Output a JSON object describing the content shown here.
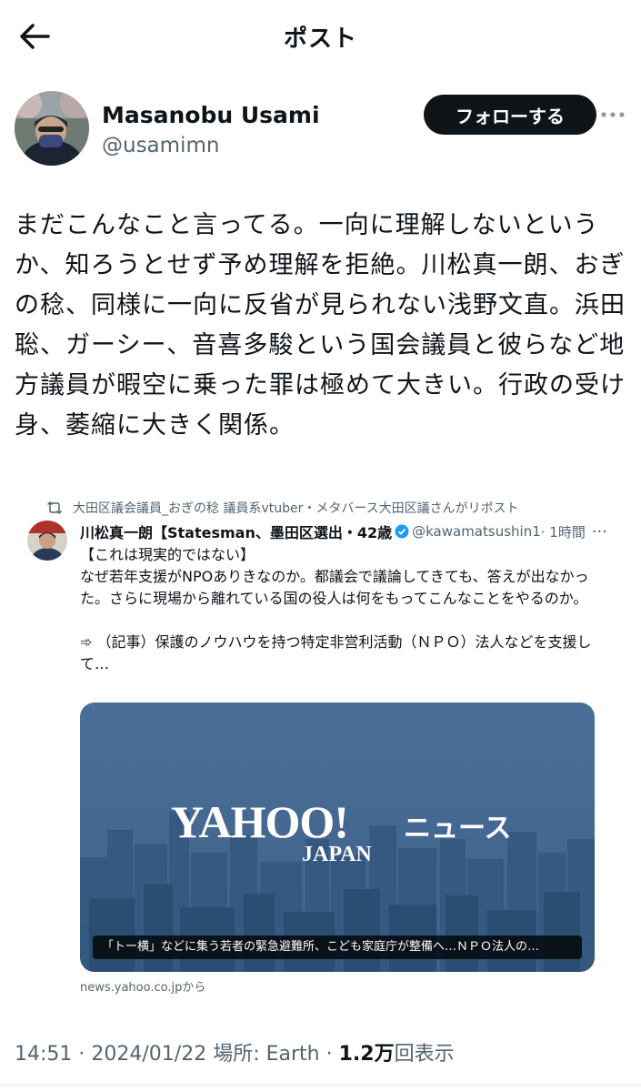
{
  "header": {
    "title": "ポスト",
    "back_icon": "arrow-left-icon"
  },
  "author": {
    "display_name": "Masanobu Usami",
    "handle": "@usamimn",
    "follow_label": "フォローする"
  },
  "tweet": {
    "text": "まだこんなこと言ってる。一向に理解しないというか、知ろうとせず予め理解を拒絶。川松真一朗、おぎの稔、同様に一向に反省が見られない浅野文直。浜田聡、ガーシー、音喜多駿という国会議員と彼らなど地方議員が暇空に乗った罪は極めて大きい。行政の受け身、萎縮に大きく関係。"
  },
  "embedded": {
    "repost_line": "大田区議会議員_おぎの稔 議員系vtuber・メタバース大田区議さんがリポスト",
    "name": "川松真一朗【Statesman、墨田区選出・42歳",
    "handle": "@kawamatsushin1",
    "time": "· 1時間",
    "more": "···",
    "line1": "【これは現実的ではない】",
    "line2": "なぜ若年支援がNPOありきなのか。都議会で議論してきても、答えが出なかった。さらに現場から離れている国の役人は何をもってこんなことをやるのか。",
    "line3": "➾ （記事）保護のノウハウを持つ特定非営利活動（ＮＰＯ）法人などを支援して…",
    "card_logo_main": "YAHOO!",
    "card_logo_sub": "JAPAN",
    "card_logo_news": "ニュース",
    "card_caption": "「トー横」などに集う若者の緊急避難所、こども家庭庁が整備へ…ＮＰＯ法人の…",
    "source": "news.yahoo.co.jpから"
  },
  "meta": {
    "time": "14:51",
    "date": "2024/01/22",
    "location_label": "場所: Earth",
    "views_count": "1.2万",
    "views_label": "回表示"
  },
  "colors": {
    "text": "#0f1419",
    "secondary": "#536471",
    "verified": "#1d9bf0",
    "button_bg": "#0f1419"
  }
}
